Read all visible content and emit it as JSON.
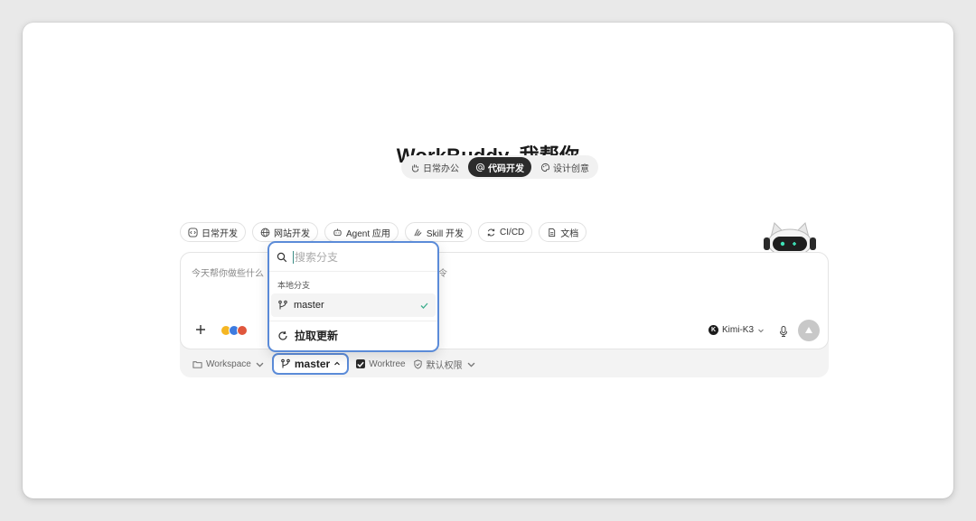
{
  "title": "WorkBuddy, 我帮你",
  "mode_tabs": [
    {
      "label": "日常办公",
      "icon": "hand-icon",
      "active": false
    },
    {
      "label": "代码开发",
      "icon": "at-icon",
      "active": true
    },
    {
      "label": "设计创意",
      "icon": "palette-icon",
      "active": false
    }
  ],
  "chips": [
    {
      "label": "日常开发",
      "icon": "code-icon"
    },
    {
      "label": "网站开发",
      "icon": "globe-icon"
    },
    {
      "label": "Agent 应用",
      "icon": "robot-icon"
    },
    {
      "label": "Skill 开发",
      "icon": "skill-icon"
    },
    {
      "label": "CI/CD",
      "icon": "cycle-icon"
    },
    {
      "label": "文档",
      "icon": "document-icon"
    }
  ],
  "composer": {
    "placeholder_head": "今天帮你做些什么",
    "placeholder_tail": "令",
    "model": "Kimi-K3",
    "model_logo_letter": "K"
  },
  "footer": {
    "workspace": "Workspace",
    "branch": "master",
    "worktree": "Worktree",
    "permission": "默认权限"
  },
  "branch_dropdown": {
    "search_placeholder": "搜索分支",
    "section_label": "本地分支",
    "branches": [
      {
        "name": "master",
        "selected": true
      }
    ],
    "pull_label": "拉取更新"
  },
  "colors": {
    "accent_border": "#5b8bd8",
    "check": "#3fae8e",
    "active_tab": "#2b2b2b"
  }
}
